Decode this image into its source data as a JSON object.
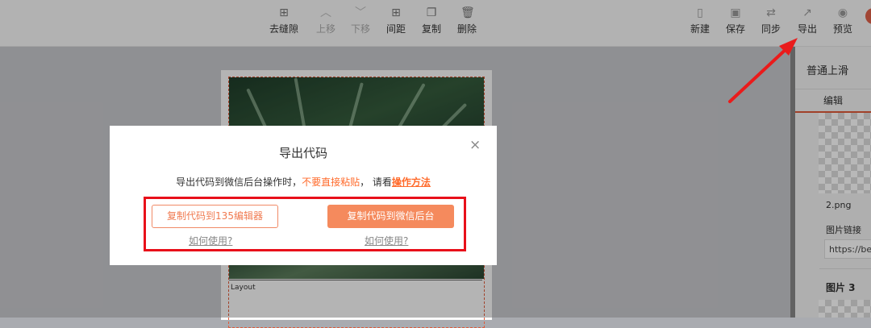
{
  "toolbar": {
    "items": [
      {
        "label": "去缝隙",
        "icon": "grid-plus-icon",
        "disabled": false
      },
      {
        "label": "上移",
        "icon": "chevron-up-icon",
        "disabled": true
      },
      {
        "label": "下移",
        "icon": "chevron-down-icon",
        "disabled": true
      },
      {
        "label": "间距",
        "icon": "spacing-icon",
        "disabled": false
      },
      {
        "label": "复制",
        "icon": "copy-icon",
        "disabled": false
      },
      {
        "label": "删除",
        "icon": "trash-icon",
        "disabled": false
      }
    ],
    "right_items": [
      {
        "label": "新建",
        "icon": "new-file-icon"
      },
      {
        "label": "保存",
        "icon": "save-icon"
      },
      {
        "label": "同步",
        "icon": "sync-icon"
      },
      {
        "label": "导出",
        "icon": "export-icon"
      },
      {
        "label": "预览",
        "icon": "eye-icon"
      }
    ]
  },
  "canvas": {
    "layout_label": "Layout"
  },
  "sidebar": {
    "title": "普通上滑",
    "tab": "编辑",
    "file_name": "2.png",
    "link_label": "图片链接",
    "link_value": "https://be",
    "picture3": "图片 3"
  },
  "modal": {
    "title": "导出代码",
    "close": "×",
    "desc_prefix": "导出代码到微信后台操作时，",
    "desc_warning": "不要直接粘贴",
    "desc_middle": "，  请看",
    "desc_link": "操作方法",
    "btn_135": "复制代码到135编辑器",
    "btn_wechat": "复制代码到微信后台",
    "howto_1": "如何使用?",
    "howto_2": "如何使用?"
  },
  "colors": {
    "accent": "#f58a5d",
    "warning_text": "#ff6b2c",
    "highlight_box": "#e8101a"
  }
}
